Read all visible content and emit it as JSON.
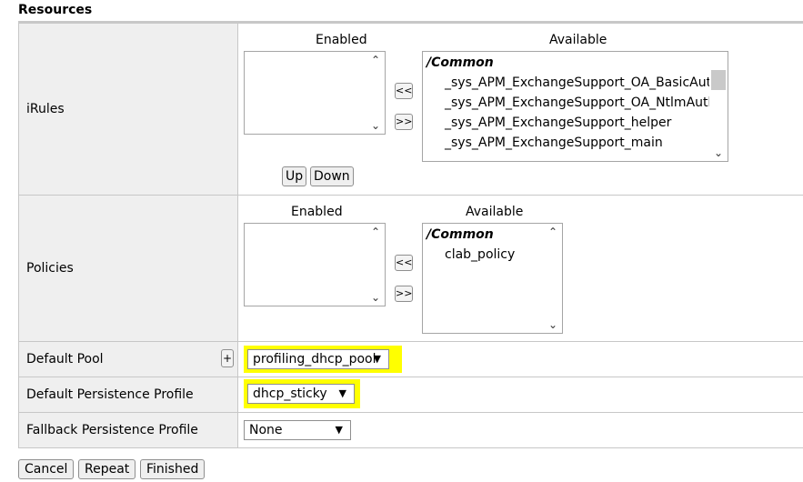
{
  "section": {
    "title": "Resources"
  },
  "irules": {
    "label": "iRules",
    "enabled_label": "Enabled",
    "available_label": "Available",
    "move_left": "<<",
    "move_right": ">>",
    "up_label": "Up",
    "down_label": "Down",
    "available_group": "/Common",
    "available_items": [
      "_sys_APM_ExchangeSupport_OA_BasicAuth",
      "_sys_APM_ExchangeSupport_OA_NtlmAuth",
      "_sys_APM_ExchangeSupport_helper",
      "_sys_APM_ExchangeSupport_main"
    ]
  },
  "policies": {
    "label": "Policies",
    "enabled_label": "Enabled",
    "available_label": "Available",
    "move_left": "<<",
    "move_right": ">>",
    "available_group": "/Common",
    "available_items": [
      "clab_policy"
    ]
  },
  "default_pool": {
    "label": "Default Pool",
    "add_label": "+",
    "value": "profiling_dhcp_pool"
  },
  "default_persistence": {
    "label": "Default Persistence Profile",
    "value": "dhcp_sticky"
  },
  "fallback_persistence": {
    "label": "Fallback Persistence Profile",
    "value": "None"
  },
  "footer": {
    "cancel": "Cancel",
    "repeat": "Repeat",
    "finished": "Finished"
  },
  "colors": {
    "highlight": "#ffff00",
    "label_bg": "#efefef",
    "border": "#c7c7c7"
  }
}
